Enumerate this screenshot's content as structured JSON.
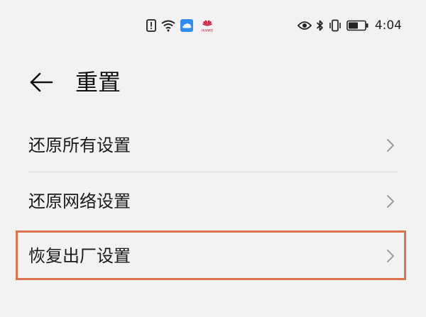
{
  "status_bar": {
    "time": "4:04",
    "left_icons": [
      "alert-icon",
      "wifi-icon",
      "cloud-app-icon",
      "huawei-logo-icon"
    ],
    "huawei_logo_text": "HUAWEI",
    "right_icons": [
      "eye-icon",
      "bluetooth-icon",
      "vibrate-icon",
      "battery-icon"
    ]
  },
  "header": {
    "title": "重置"
  },
  "list": {
    "items": [
      {
        "label": "还原所有设置"
      },
      {
        "label": "还原网络设置"
      },
      {
        "label": "恢复出厂设置"
      }
    ]
  },
  "colors": {
    "background": "#f2f2f2",
    "text": "#1a1a1a",
    "chevron": "#9e9e9e",
    "divider": "#d9d9d9",
    "highlight": "#d9744f",
    "cloud_app": "#2f8cf3",
    "huawei_logo": "#cf0a2c"
  }
}
